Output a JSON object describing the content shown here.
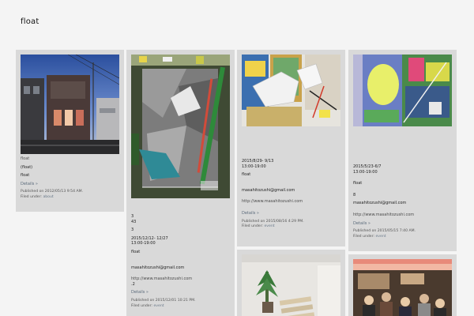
{
  "site": {
    "title": "float"
  },
  "posts": [
    {
      "title": "float",
      "lines": [
        "(float)",
        "float"
      ],
      "details": "Details »",
      "published": "Published on 2012/05/13 9:54 AM.",
      "filed_label": "Filed under:",
      "filed_cat": "about",
      "image": "house-photo"
    },
    {
      "lines_top": [
        "3",
        "43",
        "3"
      ],
      "dates": [
        "2015/12/12- 12/27",
        "13:00-19:00"
      ],
      "venue": "float",
      "email": "masahitozushi@gmail.com",
      "url": "http://www.masahitozushi.com",
      "extra": ".2",
      "details": "Details »",
      "published": "Published on 2015/12/01 10:21 PM.",
      "filed_label": "Filed under:",
      "filed_cat": "event",
      "image": "collage-poster"
    },
    {
      "dates": [
        "2015/8/29- 9/13",
        "13:00-19:00"
      ],
      "venue": "float",
      "email": "masahitozushi@gmail.com",
      "url": "http://www.masahitozushi.com",
      "details": "Details »",
      "published": "Published on 2015/08/16 4:29 PM.",
      "filed_label": "Filed under:",
      "filed_cat": "event",
      "image": "sculpture-photo"
    },
    {
      "dates": [
        "2015/5/23-6/7",
        "13:00-19:00"
      ],
      "venue": "float",
      "extra": "8",
      "email": "masahitozushi@gmail.com",
      "url": "http://www.masahitozushi.com",
      "details": "Details »",
      "published": "Published on 2015/05/15 7:40 AM.",
      "filed_label": "Filed under:",
      "filed_cat": "event",
      "image": "painting-poster"
    },
    {
      "image": "gallery-interior-photo"
    },
    {
      "image": "crowd-photo"
    }
  ]
}
